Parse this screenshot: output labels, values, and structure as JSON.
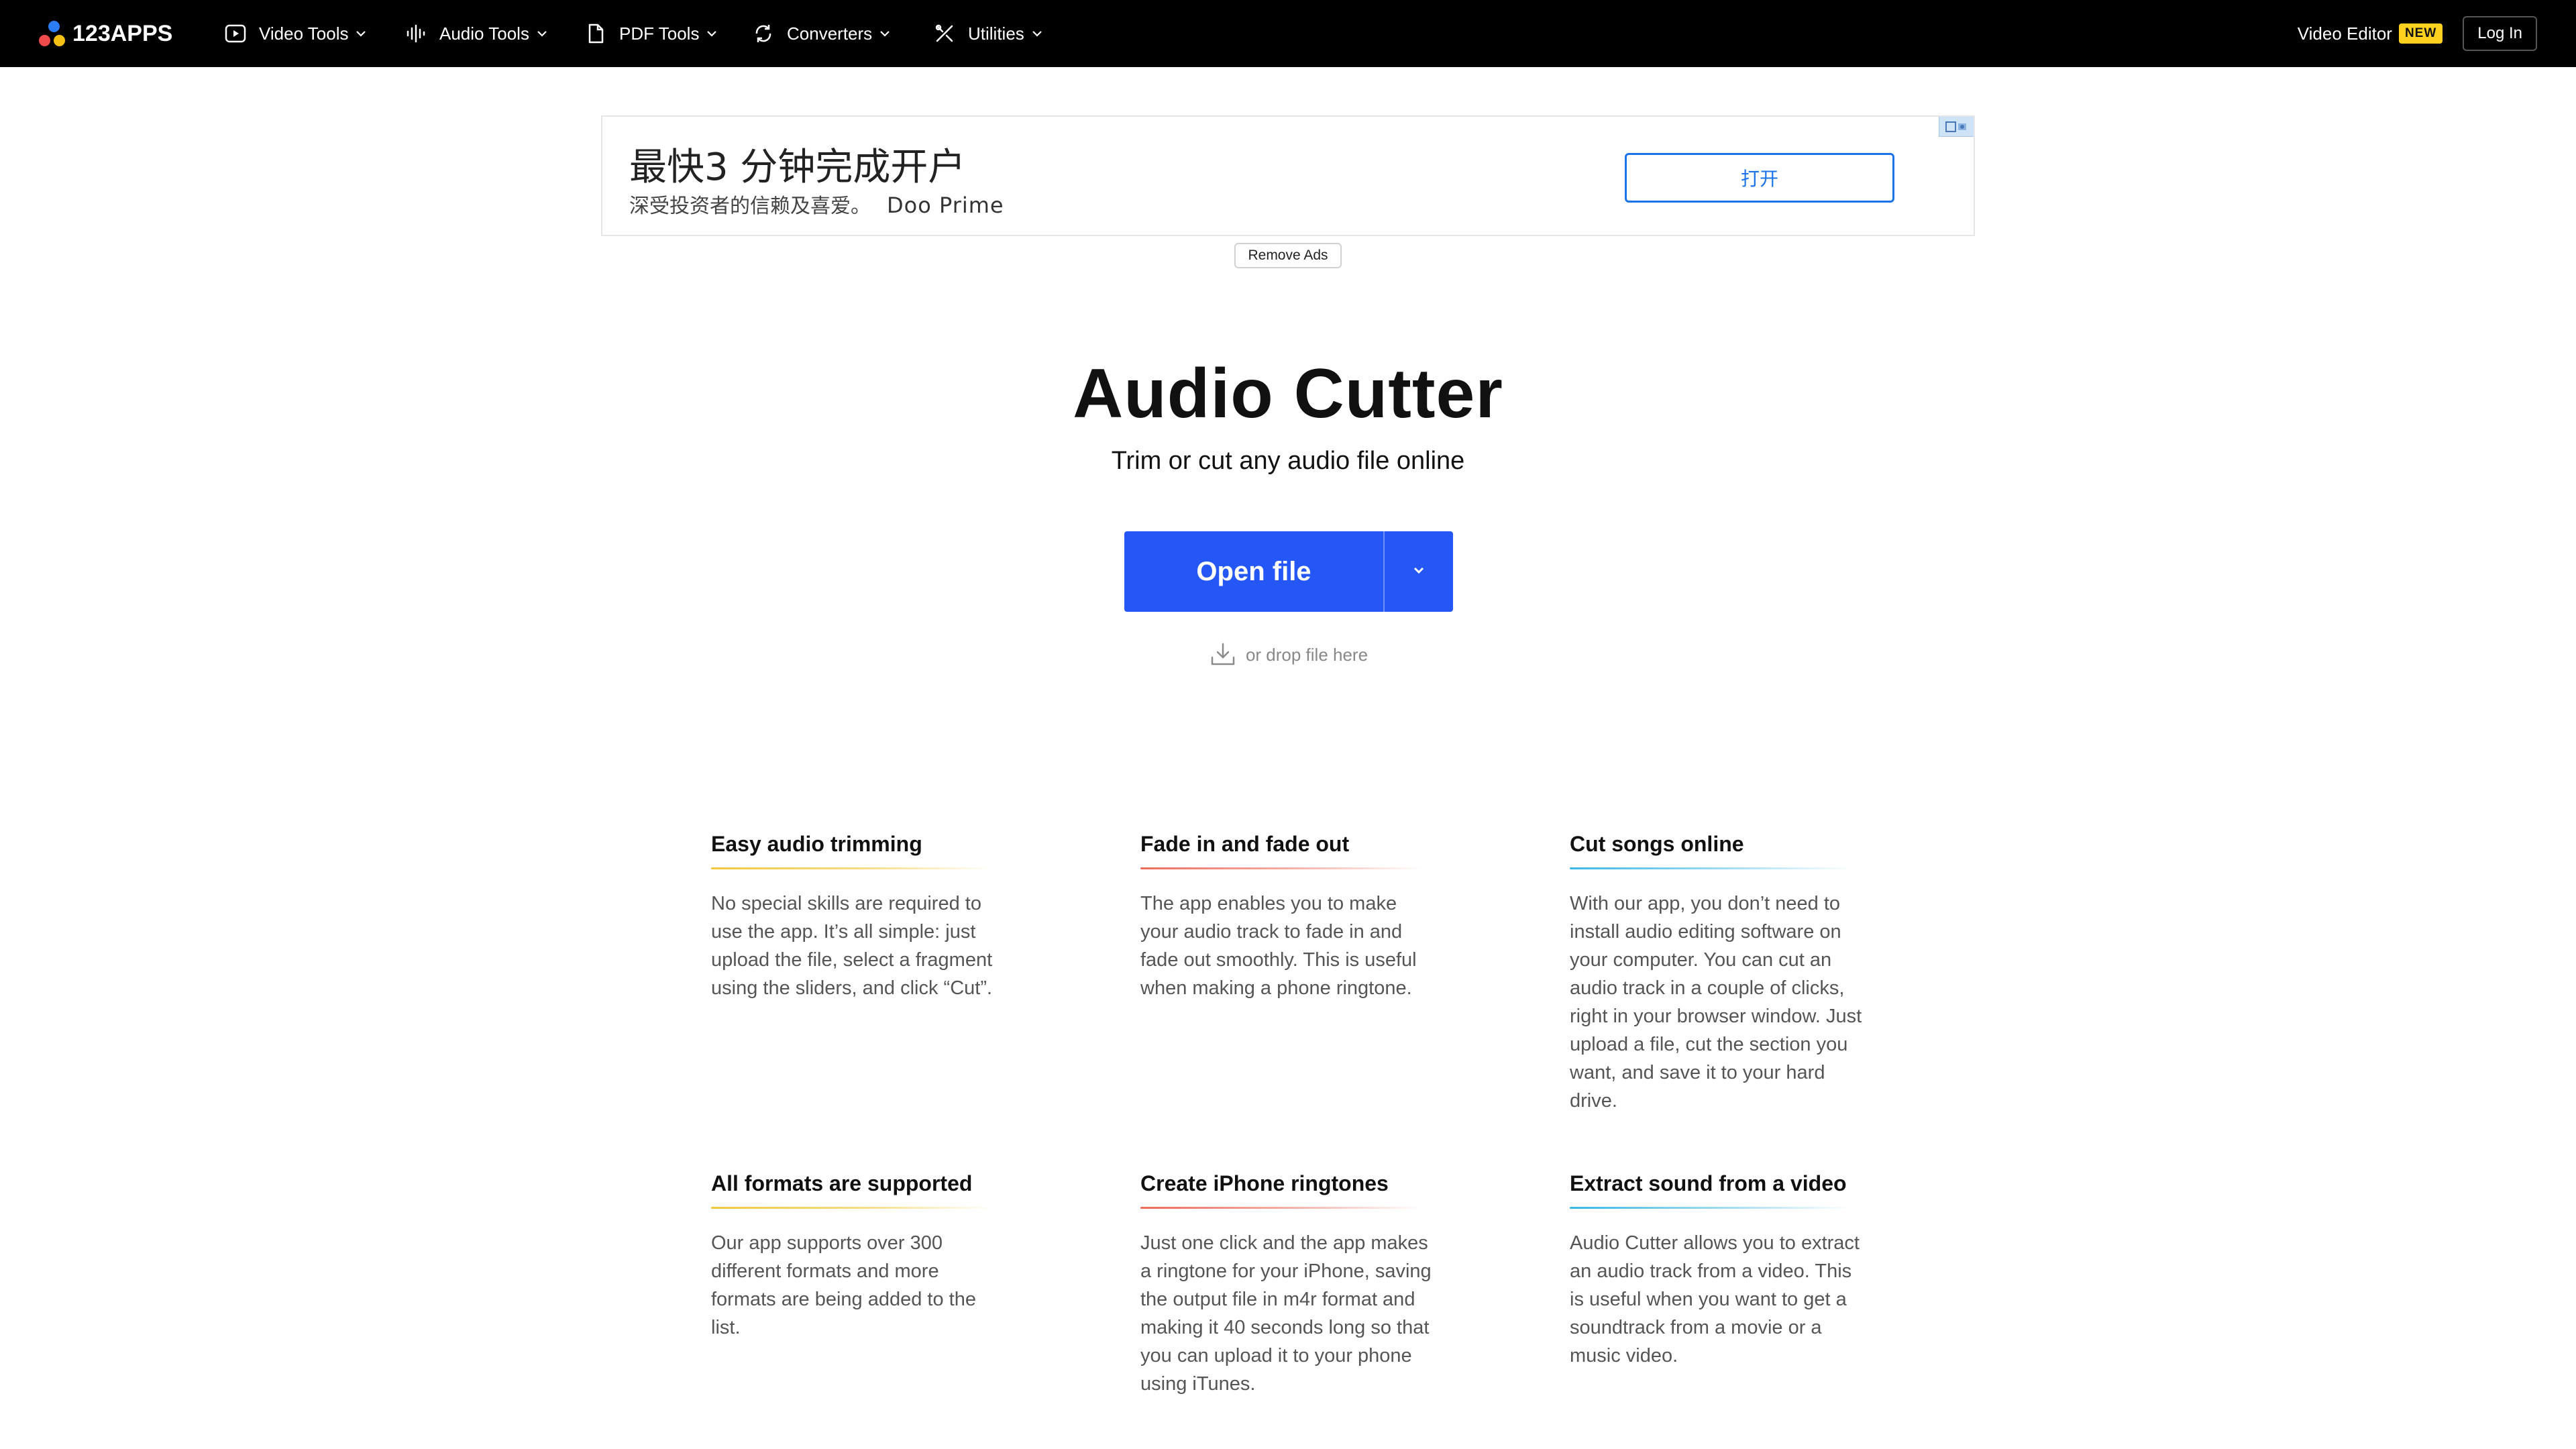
{
  "header": {
    "logo_text": "123APPS",
    "nav": [
      {
        "label": "Video Tools",
        "icon": "play-icon"
      },
      {
        "label": "Audio Tools",
        "icon": "waveform-icon"
      },
      {
        "label": "PDF Tools",
        "icon": "document-icon"
      },
      {
        "label": "Converters",
        "icon": "convert-icon"
      },
      {
        "label": "Utilities",
        "icon": "tools-icon"
      }
    ],
    "video_editor_label": "Video Editor",
    "new_badge": "NEW",
    "login_label": "Log In"
  },
  "ad": {
    "title": "最快3 分钟完成开户",
    "subtitle": "深受投资者的信赖及喜爱。",
    "brand": "Doo Prime",
    "button_label": "打开",
    "remove_ads_label": "Remove Ads"
  },
  "hero": {
    "title": "Audio Cutter",
    "subtitle": "Trim or cut any audio file online",
    "open_file_label": "Open file",
    "drop_hint": "or drop file here"
  },
  "features": [
    {
      "title": "Easy audio trimming",
      "text": "No special skills are required to use the app. It’s all simple: just upload the file, select a fragment using the sliders, and click “Cut”.",
      "accent": "yellow"
    },
    {
      "title": "Fade in and fade out",
      "text": "The app enables you to make your audio track to fade in and fade out smoothly. This is useful when making a phone ringtone.",
      "accent": "red"
    },
    {
      "title": "Cut songs online",
      "text": "With our app, you don’t need to install audio editing software on your computer. You can cut an audio track in a couple of clicks, right in your browser window. Just upload a file, cut the section you want, and save it to your hard drive.",
      "accent": "blue"
    },
    {
      "title": "All formats are supported",
      "text": "Our app supports over 300 different formats and more formats are being added to the list.",
      "accent": "yellow"
    },
    {
      "title": "Create iPhone ringtones",
      "text": "Just one click and the app makes a ringtone for your iPhone, saving the output file in m4r format and making it 40 seconds long so that you can upload it to your phone using iTunes.",
      "accent": "red"
    },
    {
      "title": "Extract sound from a video",
      "text": "Audio Cutter allows you to extract an audio track from a video. This is useful when you want to get a soundtrack from a movie or a music video.",
      "accent": "blue"
    }
  ],
  "colors": {
    "topbar": "#000000",
    "primary_button": "#2457f5",
    "badge": "#ffd21f",
    "ad_button": "#1a73e8"
  }
}
